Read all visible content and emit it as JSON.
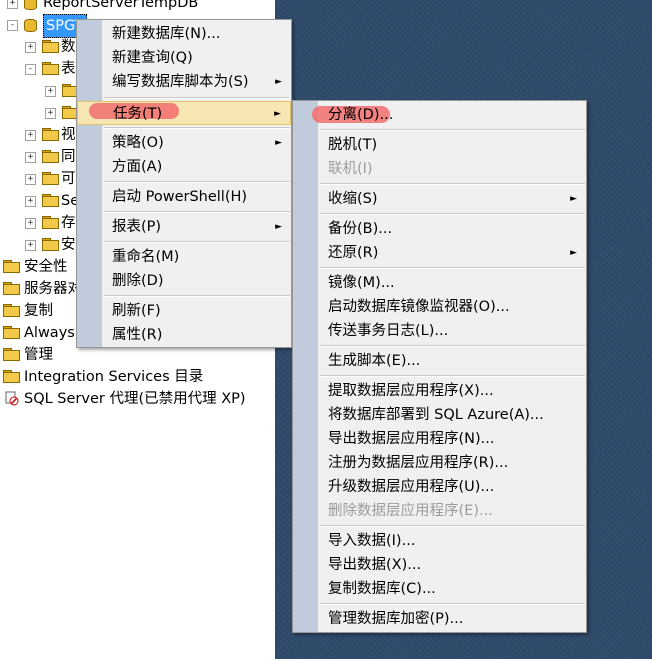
{
  "tree": {
    "items": [
      {
        "text": "ReportServerTempDB",
        "pm": "+",
        "icon": "db"
      },
      {
        "text": "SPGT",
        "pm": "-",
        "icon": "db",
        "selected": true
      },
      {
        "text": "数",
        "pm": "+",
        "icon": "folder"
      },
      {
        "text": "表",
        "pm": "-",
        "icon": "folder"
      },
      {
        "text": "",
        "pm": "+",
        "icon": "folder"
      },
      {
        "text": "",
        "pm": "+",
        "icon": "folder"
      },
      {
        "text": "视",
        "pm": "+",
        "icon": "folder"
      },
      {
        "text": "同",
        "pm": "+",
        "icon": "folder"
      },
      {
        "text": "可",
        "pm": "+",
        "icon": "folder"
      },
      {
        "text": "Se",
        "pm": "+",
        "icon": "folder"
      },
      {
        "text": "存",
        "pm": "+",
        "icon": "folder"
      },
      {
        "text": "安",
        "pm": "+",
        "icon": "folder"
      },
      {
        "text": "安全性",
        "pm": "",
        "icon": "folder"
      },
      {
        "text": "服务器对",
        "pm": "",
        "icon": "folder"
      },
      {
        "text": "复制",
        "pm": "",
        "icon": "folder"
      },
      {
        "text": "Always",
        "pm": "",
        "icon": "folder"
      },
      {
        "text": "管理",
        "pm": "",
        "icon": "folder"
      },
      {
        "text": "Integration Services 目录",
        "pm": "",
        "icon": "folder"
      },
      {
        "text": "SQL Server 代理(已禁用代理 XP)",
        "pm": "",
        "icon": "agent"
      }
    ]
  },
  "context_menu": {
    "items": [
      {
        "label": "新建数据库(N)...",
        "arrow": ""
      },
      {
        "label": "新建查询(Q)",
        "arrow": ""
      },
      {
        "label": "编写数据库脚本为(S)",
        "arrow": "►"
      },
      {
        "label": "任务(T)",
        "arrow": "►",
        "highlighted": true
      },
      {
        "label": "策略(O)",
        "arrow": "►"
      },
      {
        "label": "方面(A)",
        "arrow": ""
      },
      {
        "label": "启动 PowerShell(H)",
        "arrow": ""
      },
      {
        "label": "报表(P)",
        "arrow": "►"
      },
      {
        "label": "重命名(M)",
        "arrow": ""
      },
      {
        "label": "删除(D)",
        "arrow": ""
      },
      {
        "label": "刷新(F)",
        "arrow": ""
      },
      {
        "label": "属性(R)",
        "arrow": ""
      }
    ]
  },
  "tasks_menu": {
    "items": [
      {
        "label": "分离(D)...",
        "arrow": ""
      },
      {
        "label": "脱机(T)",
        "arrow": ""
      },
      {
        "label": "联机(I)",
        "arrow": "",
        "disabled": true
      },
      {
        "label": "收缩(S)",
        "arrow": "►"
      },
      {
        "label": "备份(B)...",
        "arrow": ""
      },
      {
        "label": "还原(R)",
        "arrow": "►"
      },
      {
        "label": "镜像(M)...",
        "arrow": ""
      },
      {
        "label": "启动数据库镜像监视器(O)...",
        "arrow": ""
      },
      {
        "label": "传送事务日志(L)...",
        "arrow": ""
      },
      {
        "label": "生成脚本(E)...",
        "arrow": ""
      },
      {
        "label": "提取数据层应用程序(X)...",
        "arrow": ""
      },
      {
        "label": "将数据库部署到 SQL Azure(A)...",
        "arrow": ""
      },
      {
        "label": "导出数据层应用程序(N)...",
        "arrow": ""
      },
      {
        "label": "注册为数据层应用程序(R)...",
        "arrow": ""
      },
      {
        "label": "升级数据层应用程序(U)...",
        "arrow": ""
      },
      {
        "label": "删除数据层应用程序(E)...",
        "arrow": "",
        "disabled": true
      },
      {
        "label": "导入数据(I)...",
        "arrow": ""
      },
      {
        "label": "导出数据(X)...",
        "arrow": ""
      },
      {
        "label": "复制数据库(C)...",
        "arrow": ""
      },
      {
        "label": "管理数据库加密(P)...",
        "arrow": ""
      }
    ]
  },
  "colors": {
    "accent_mark": "#f26d6d",
    "selection": "#3399ff",
    "desktop": "#2f4a6b"
  }
}
